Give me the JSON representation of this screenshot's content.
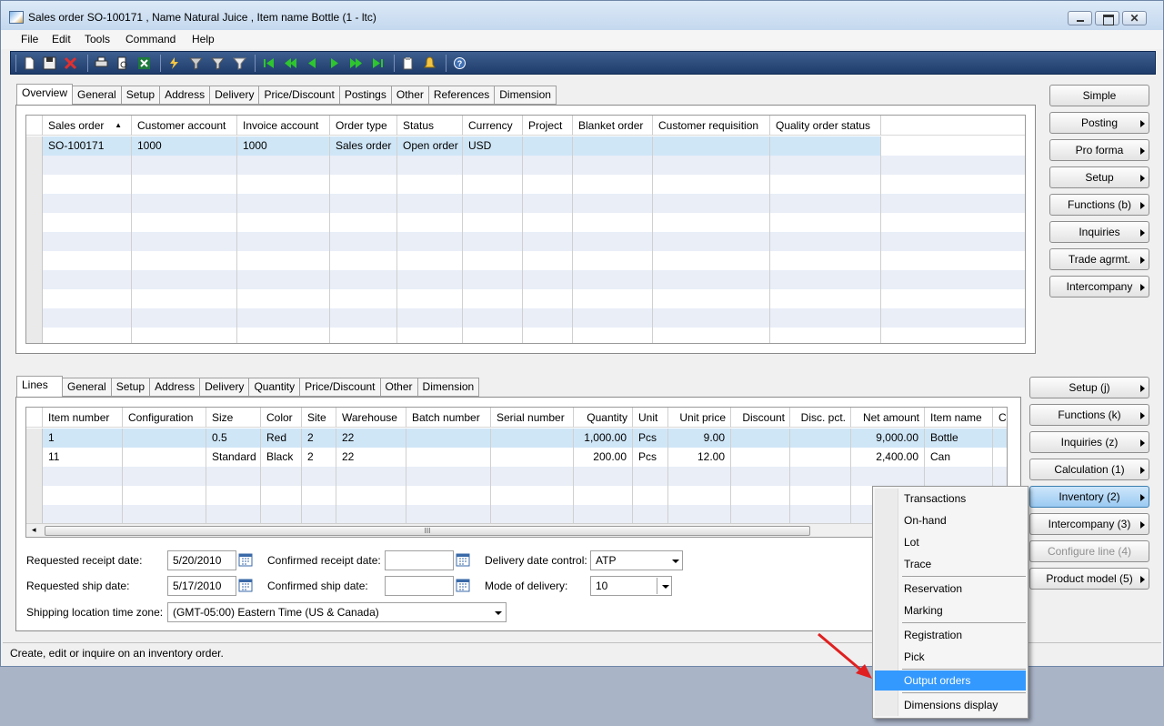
{
  "window": {
    "title": "Sales order SO-100171 , Name Natural Juice , Item name Bottle (1 - ltc)"
  },
  "menu": {
    "items": [
      "File",
      "Edit",
      "Tools",
      "Command",
      "Help"
    ]
  },
  "header_tabs": [
    "Overview",
    "General",
    "Setup",
    "Address",
    "Delivery",
    "Price/Discount",
    "Postings",
    "Other",
    "References",
    "Dimension"
  ],
  "header_grid": {
    "columns": [
      "Sales order",
      "Customer account",
      "Invoice account",
      "Order type",
      "Status",
      "Currency",
      "Project",
      "Blanket order",
      "Customer requisition",
      "Quality order status"
    ],
    "rows": [
      [
        "SO-100171",
        "1000",
        "1000",
        "Sales order",
        "Open order",
        "USD",
        "",
        "",
        "",
        ""
      ]
    ]
  },
  "header_buttons": [
    "Simple",
    "Posting",
    "Pro forma",
    "Setup",
    "Functions (b)",
    "Inquiries",
    "Trade agrmt.",
    "Intercompany"
  ],
  "lines_tabs": [
    "Lines",
    "General",
    "Setup",
    "Address",
    "Delivery",
    "Quantity",
    "Price/Discount",
    "Other",
    "Dimension"
  ],
  "lines_grid": {
    "columns": [
      "Item number",
      "Configuration",
      "Size",
      "Color",
      "Site",
      "Warehouse",
      "Batch number",
      "Serial number",
      "Quantity",
      "Unit",
      "Unit price",
      "Discount",
      "Disc. pct.",
      "Net amount",
      "Item name",
      "C"
    ],
    "rows": [
      [
        "1",
        "",
        "0.5",
        "Red",
        "2",
        "22",
        "",
        "",
        "1,000.00",
        "Pcs",
        "9.00",
        "",
        "",
        "9,000.00",
        "Bottle",
        ""
      ],
      [
        "11",
        "",
        "Standard",
        "Black",
        "2",
        "22",
        "",
        "",
        "200.00",
        "Pcs",
        "12.00",
        "",
        "",
        "2,400.00",
        "Can",
        ""
      ]
    ]
  },
  "scroll_grip": "III",
  "lines_buttons": [
    "Setup (j)",
    "Functions (k)",
    "Inquiries (z)",
    "Calculation (1)",
    "Inventory (2)",
    "Intercompany (3)",
    "Configure line (4)",
    "Product model (5)"
  ],
  "form": {
    "requested_receipt_label": "Requested receipt date:",
    "requested_receipt_value": "5/20/2010",
    "requested_ship_label": "Requested ship date:",
    "requested_ship_value": "5/17/2010",
    "confirmed_receipt_label": "Confirmed receipt date:",
    "confirmed_receipt_value": "",
    "confirmed_ship_label": "Confirmed ship date:",
    "confirmed_ship_value": "",
    "delivery_control_label": "Delivery date control:",
    "delivery_control_value": "ATP",
    "mode_label": "Mode of delivery:",
    "mode_value": "10",
    "timezone_label": "Shipping location time zone:",
    "timezone_value": "(GMT-05:00) Eastern Time (US & Canada)"
  },
  "status_text": "Create, edit or inquire on an inventory order.",
  "context_menu": {
    "items": [
      "Transactions",
      "On-hand",
      "Lot",
      "Trace",
      "Reservation",
      "Marking",
      "Registration",
      "Pick",
      "Output orders",
      "Dimensions display"
    ],
    "highlighted": "Output orders"
  },
  "colors": {
    "toolbar": "#2b4a7a",
    "highlight": "#3399ff",
    "selected_row": "#cfe6f7",
    "alt_row": "#e9eef7",
    "arrow": "#e02020"
  }
}
